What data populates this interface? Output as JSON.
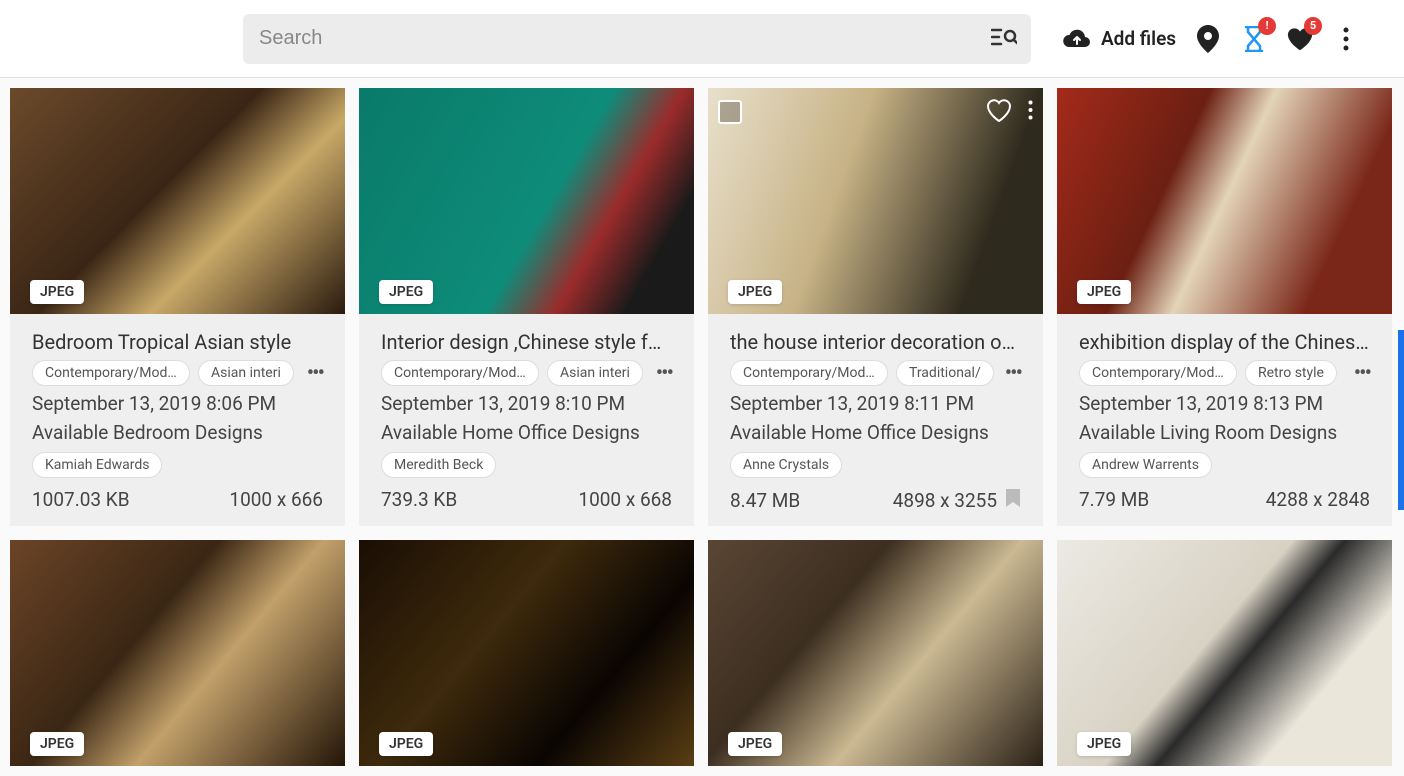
{
  "header": {
    "search_placeholder": "Search",
    "add_files": "Add files",
    "hourglass_badge": "!",
    "favorites_badge": "5"
  },
  "cards": [
    {
      "format": "JPEG",
      "title": "Bedroom Tropical Asian style",
      "tags": [
        "Contemporary/Modern",
        "Asian interi"
      ],
      "date": "September 13, 2019 8:06 PM",
      "category": "Available Bedroom Designs",
      "author": "Kamiah Edwards",
      "size": "1007.03 KB",
      "dims": "1000 x 666",
      "show_overlay": false,
      "show_bookmark": false,
      "bg": "linear-gradient(135deg,#6b4a2a 0%,#3a2515 45%,#c9a968 65%,#2a1a0e 100%)"
    },
    {
      "format": "JPEG",
      "title": "Interior design ,Chinese style fo...",
      "tags": [
        "Contemporary/Modern",
        "Asian interi"
      ],
      "date": "September 13, 2019 8:10 PM",
      "category": "Available Home Office Designs",
      "author": "Meredith Beck",
      "size": "739.3 KB",
      "dims": "1000 x 668",
      "show_overlay": false,
      "show_bookmark": false,
      "bg": "linear-gradient(120deg,#0a7a6a 0%,#0e8c7a 55%,#9a2b2b 70%,#1a1a1a 85%)"
    },
    {
      "format": "JPEG",
      "title": "the house interior decoration of...",
      "tags": [
        "Contemporary/Modern",
        "Traditional/"
      ],
      "date": "September 13, 2019 8:11 PM",
      "category": "Available Home Office Designs",
      "author": "Anne Crystals",
      "size": "8.47 MB",
      "dims": "4898 x 3255",
      "show_overlay": true,
      "show_bookmark": true,
      "bg": "linear-gradient(110deg,#e8e0cc 0%,#c7b285 40%,#2f2a1e 80%)"
    },
    {
      "format": "JPEG",
      "title": "exhibition display of the Chines...",
      "tags": [
        "Contemporary/Modern",
        "Retro style"
      ],
      "date": "September 13, 2019 8:13 PM",
      "category": "Available Living Room Designs",
      "author": "Andrew Warrents",
      "size": "7.79 MB",
      "dims": "4288 x 2848",
      "show_overlay": false,
      "show_bookmark": false,
      "bg": "linear-gradient(115deg,#a42a1a 0%,#6b1f12 35%,#e3d4b8 50%,#7a2618 80%)"
    }
  ],
  "cards2": [
    {
      "format": "JPEG",
      "bg": "linear-gradient(130deg,#6b4426 0%,#3a2614 40%,#c2a06a 60%,#241508 100%)"
    },
    {
      "format": "JPEG",
      "bg": "linear-gradient(130deg,#1a0e04 0%,#3e2a0c 40%,#0a0502 70%,#5a3e14 100%)"
    },
    {
      "format": "JPEG",
      "bg": "linear-gradient(130deg,#5a4634 0%,#3c2e20 35%,#cbb992 60%,#2a2016 100%)"
    },
    {
      "format": "JPEG",
      "bg": "linear-gradient(130deg,#eceae4 0%,#d8d2c4 45%,#2a2a2a 55%,#ebe6da 75%)"
    }
  ]
}
